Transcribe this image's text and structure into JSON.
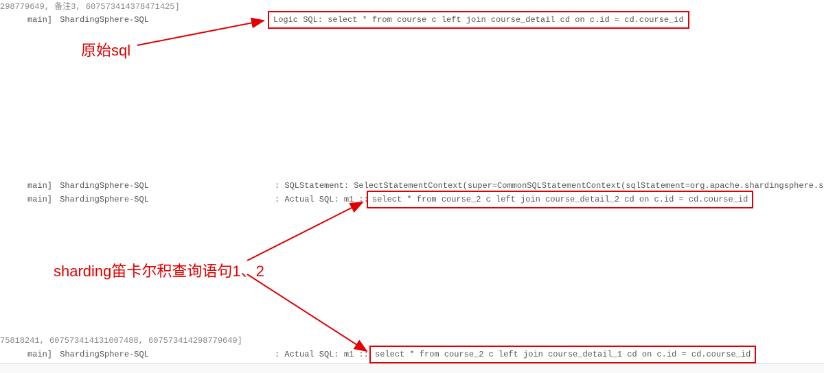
{
  "lines": {
    "l0": {
      "text": "298779649, 备注3, 607573414378471425]"
    },
    "l1": {
      "thread": "main]",
      "logger": "ShardingSphere-SQL",
      "prefix": ": ",
      "boxed": "Logic SQL: select * from course c left join course_detail cd on c.id = cd.course_id"
    },
    "l2": {
      "thread": "main]",
      "logger": "ShardingSphere-SQL",
      "prefix": ": ",
      "msg": "SQLStatement: SelectStatementContext(super=CommonSQLStatementContext(sqlStatement=org.apache.shardingsphere.sql.pa"
    },
    "l3": {
      "thread": "main]",
      "logger": "ShardingSphere-SQL",
      "prefix": ": Actual SQL: m1 ::",
      "boxed": "select * from course_2 c left join course_detail_2 cd on c.id = cd.course_id"
    },
    "l4": {
      "text": "75818241, 607573414131007488, 607573414298779649]"
    },
    "l5": {
      "thread": "main]",
      "logger": "ShardingSphere-SQL",
      "prefix": ": Actual SQL: m1 ::",
      "boxed": "select * from course_2 c left join course_detail_1 cd on c.id = cd.course_id"
    }
  },
  "annotations": {
    "a1": "原始sql",
    "a2": "sharding笛卡尔积查询语句1、2"
  }
}
